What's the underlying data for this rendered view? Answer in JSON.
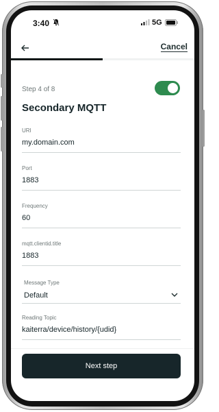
{
  "status_bar": {
    "time": "3:40",
    "network": "5G"
  },
  "header": {
    "cancel_label": "Cancel",
    "progress": 0.5
  },
  "step": {
    "label": "Step 4 of 8",
    "enabled": true
  },
  "title": "Secondary MQTT",
  "fields": {
    "uri": {
      "label": "URI",
      "value": "my.domain.com"
    },
    "port": {
      "label": "Port",
      "value": "1883"
    },
    "frequency": {
      "label": "Frequency",
      "value": "60"
    },
    "client_id": {
      "label": "mqtt.clientid.title",
      "value": "1883"
    },
    "message_type": {
      "label": "Message Type",
      "value": "Default"
    },
    "reading_topic": {
      "label": "Reading Topic",
      "value": "kaiterra/device/history/{udid}"
    }
  },
  "footer": {
    "next_label": "Next step"
  },
  "colors": {
    "accent_green": "#2e8b4f",
    "primary_dark": "#17262a"
  }
}
